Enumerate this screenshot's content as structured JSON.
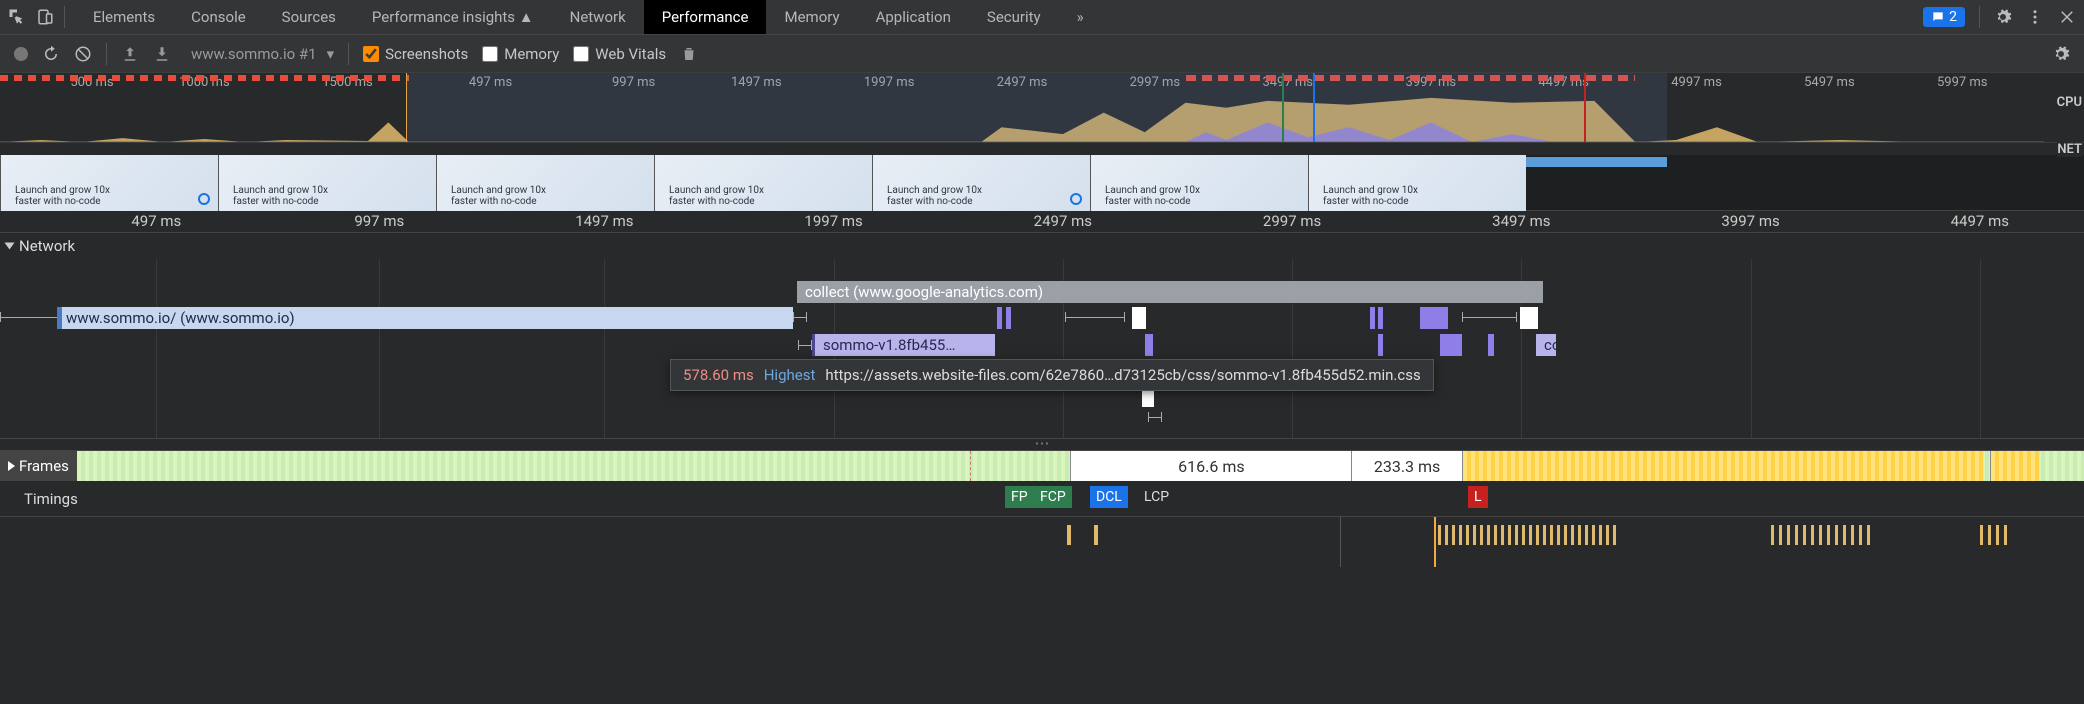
{
  "tabs": [
    "Elements",
    "Console",
    "Sources",
    "Performance insights ▲",
    "Network",
    "Performance",
    "Memory",
    "Application",
    "Security"
  ],
  "active_tab": "Performance",
  "chat_count": "2",
  "toolbar": {
    "profile": "www.sommo.io #1",
    "screenshots": "Screenshots",
    "memory": "Memory",
    "web_vitals": "Web Vitals"
  },
  "overview": {
    "ticks": [
      "500 ms",
      "1000 ms",
      "1500 ms",
      "497 ms",
      "997 ms",
      "1497 ms",
      "1997 ms",
      "2497 ms",
      "2997 ms",
      "3497 ms",
      "3997 ms",
      "4497 ms",
      "4997 ms",
      "5497 ms",
      "5997 ms"
    ],
    "cpu_label": "CPU",
    "net_label": "NET"
  },
  "filmstrip_caption": "Launch and grow 10x faster with no-code",
  "detail_ticks": [
    "497 ms",
    "997 ms",
    "1497 ms",
    "1997 ms",
    "2497 ms",
    "2997 ms",
    "3497 ms",
    "3997 ms",
    "4497 ms"
  ],
  "tracks": {
    "network": "Network",
    "frames": "Frames",
    "timings": "Timings"
  },
  "network_items": {
    "doc": "www.sommo.io/ (www.sommo.io)",
    "collect": "collect (www.google-analytics.com)",
    "css": "sommo-v1.8fb455…",
    "co": "co"
  },
  "tooltip": {
    "time": "578.60 ms",
    "priority": "Highest",
    "url": "https://assets.website-files.com/62e7860…d73125cb/css/sommo-v1.8fb455d52.min.css"
  },
  "frames": {
    "f1": "616.6 ms",
    "f2": "233.3 ms"
  },
  "timings": {
    "fp": "FP",
    "fcp": "FCP",
    "dcl": "DCL",
    "lcp": "LCP",
    "l": "L"
  }
}
